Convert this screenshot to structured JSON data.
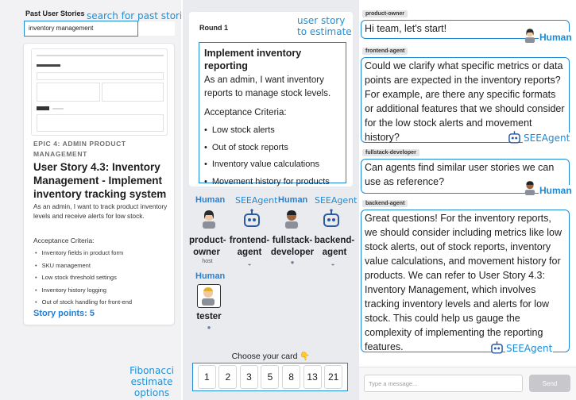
{
  "left": {
    "section_title": "Past User Stories",
    "search_value": "inventory management",
    "story": {
      "epic": "EPIC 4: ADMIN PRODUCT MANAGEMENT",
      "title": "User Story 4.3: Inventory Management - Implement inventory tracking system",
      "description": "As an admin, I want to track product inventory levels and receive alerts for low stock.",
      "ac_label": "Acceptance Criteria:",
      "criteria": [
        "Inventory fields in product form",
        "SKU management",
        "Low stock threshold settings",
        "Inventory history logging",
        "Out of stock handling for front-end"
      ],
      "points": "Story points: 5"
    }
  },
  "center": {
    "round": "Round 1",
    "story_title": "Implement inventory reporting",
    "story_text": "As an admin, I want inventory reports to manage stock levels.",
    "ac_label": "Acceptance Criteria:",
    "criteria": [
      "Low stock alerts",
      "Out of stock reports",
      "Inventory value calculations",
      "Movement history for products"
    ],
    "players": [
      {
        "tag": "Human",
        "name": "product-owner",
        "sub": "host"
      },
      {
        "tag": "SEEAgent",
        "name": "frontend-agent",
        "sub": ""
      },
      {
        "tag": "Human",
        "name": "fullstack-developer",
        "sub": ""
      },
      {
        "tag": "SEEAgent",
        "name": "backend-agent",
        "sub": ""
      },
      {
        "tag": "Human",
        "name": "tester",
        "sub": ""
      }
    ],
    "choose_label": "Choose your card 👇",
    "cards": [
      "1",
      "2",
      "3",
      "5",
      "8",
      "13",
      "21"
    ]
  },
  "chat": {
    "messages": [
      {
        "sender": "product-owner",
        "text": "Hi team, let's start!",
        "role": "Human"
      },
      {
        "sender": "frontend-agent",
        "text": "Could we clarify what specific metrics or data points are expected in the inventory reports? For example, are there any specific formats or additional features that we should consider for the low stock alerts and movement history?",
        "role": "SEEAgent"
      },
      {
        "sender": "fullstack-developer",
        "text": "Can agents find similar user stories we can use as reference?",
        "role": "Human"
      },
      {
        "sender": "backend-agent",
        "text": "Great questions! For the inventory reports, we should consider including metrics like low stock alerts, out of stock reports, inventory value calculations, and movement history for products. We can refer to User Story 4.3: Inventory Management, which involves tracking inventory levels and alerts for low stock. This could help us gauge the complexity of implementing the reporting features.",
        "role": "SEEAgent"
      }
    ],
    "input_placeholder": "Type a message...",
    "send_label": "Send"
  },
  "callouts": {
    "search": "search for past stories",
    "story": "user story to estimate",
    "fibonacci": "Fibonacci estimate options"
  },
  "colors": {
    "accent": "#1e8ad6",
    "human": "#2c7fd0"
  }
}
